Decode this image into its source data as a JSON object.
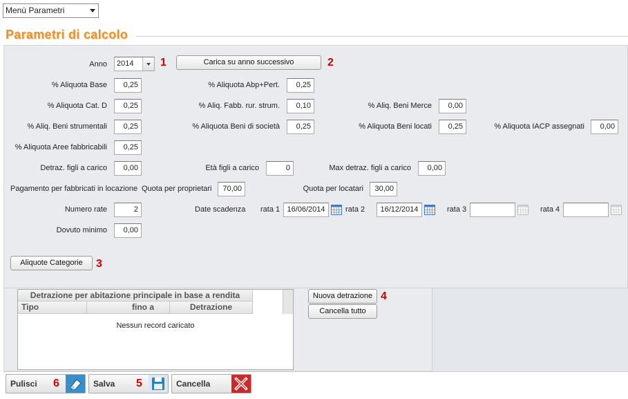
{
  "menu": {
    "value": "Menù Parametri"
  },
  "section_title": "Parametri di calcolo",
  "anno": {
    "label": "Anno",
    "value": "2014",
    "marker": "1"
  },
  "carica": {
    "label": "Carica su anno successivo",
    "marker": "2"
  },
  "aliquote": {
    "base": {
      "label": "% Aliquota Base",
      "value": "0,25"
    },
    "abp": {
      "label": "% Aliquota Abp+Pert.",
      "value": "0,25"
    },
    "catd": {
      "label": "% Aliquota Cat. D",
      "value": "0,25"
    },
    "fabb": {
      "label": "% Aliq. Fabb. rur. strum.",
      "value": "0,10"
    },
    "merce": {
      "label": "% Aliq. Beni Merce",
      "value": "0,00"
    },
    "strum": {
      "label": "% Aliq. Beni strumentali",
      "value": "0,25"
    },
    "societa": {
      "label": "% Aliquota Beni di società",
      "value": "0,25"
    },
    "locati": {
      "label": "% Aliquota Beni locati",
      "value": "0,25"
    },
    "iacp": {
      "label": "% Aliquota IACP assegnati",
      "value": "0,00"
    },
    "aree": {
      "label": "% Aliquota Aree fabbricabili",
      "value": "0,25"
    }
  },
  "figli": {
    "detraz": {
      "label": "Detraz. figli a carico",
      "value": "0,00"
    },
    "eta": {
      "label": "Età figli a carico",
      "value": "0"
    },
    "max": {
      "label": "Max detraz. figli a carico",
      "value": "0,00"
    }
  },
  "locazione": {
    "label": "Pagamento per fabbricati in locazione",
    "proprietari": {
      "label": "Quota per proprietari",
      "value": "70,00"
    },
    "locatari": {
      "label": "Quota per locatari",
      "value": "30,00"
    }
  },
  "rate": {
    "numero": {
      "label": "Numero rate",
      "value": "2"
    },
    "date_label": "Date scadenza",
    "rata1": {
      "label": "rata 1",
      "value": "16/06/2014"
    },
    "rata2": {
      "label": "rata 2",
      "value": "16/12/2014"
    },
    "rata3": {
      "label": "rata 3",
      "value": ""
    },
    "rata4": {
      "label": "rata 4",
      "value": ""
    }
  },
  "dovuto": {
    "label": "Dovuto minimo",
    "value": "0,00"
  },
  "aliquote_categorie": {
    "label": "Aliquote Categorie",
    "marker": "3"
  },
  "grid": {
    "title": "Detrazione per abitazione principale in base a rendita",
    "columns": [
      "Tipo",
      "fino a",
      "Detrazione"
    ],
    "empty": "Nessun record caricato"
  },
  "nuova_detrazione": {
    "label": "Nuova detrazione",
    "marker": "4"
  },
  "cancella_tutto": {
    "label": "Cancella tutto"
  },
  "footer": {
    "pulisci": {
      "label": "Pulisci",
      "marker": "6"
    },
    "salva": {
      "label": "Salva",
      "marker": "5"
    },
    "cancella": {
      "label": "Cancella"
    }
  },
  "colors": {
    "title": "#e8912d",
    "marker": "#d40000",
    "panel": "#e9ebee"
  }
}
